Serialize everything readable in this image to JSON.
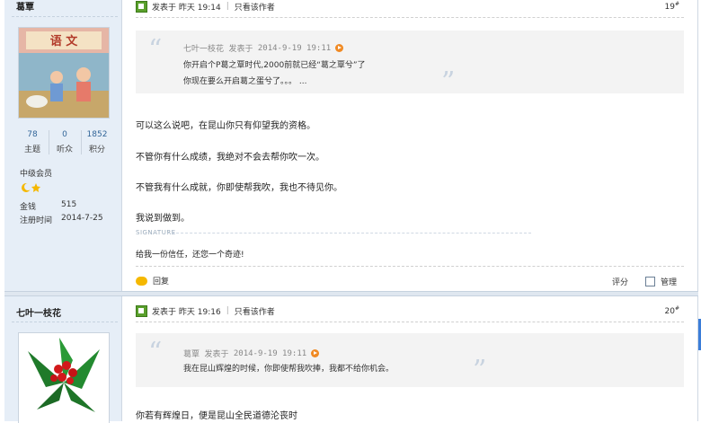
{
  "post1": {
    "username": "葛覃",
    "stats": [
      {
        "num": "78",
        "label": "主题"
      },
      {
        "num": "0",
        "label": "听众"
      },
      {
        "num": "1852",
        "label": "积分"
      }
    ],
    "group": "中级会员",
    "money_label": "金钱",
    "money_value": "515",
    "regtime_label": "注册时间",
    "regtime_value": "2014-7-25",
    "post_meta": "发表于",
    "post_time": "昨天 19:14",
    "only_author": "只看该作者",
    "floor": "19",
    "quote": {
      "author": "七叶一枝花",
      "posted": "发表于",
      "time": "2014-9-19 19:11",
      "lines": [
        "你开启个P葛之覃时代,2000前就已经“葛之覃兮”了",
        "你现在要么开启葛之蛋兮了。。。 ..."
      ]
    },
    "body": [
      "可以这么说吧，在昆山你只有仰望我的资格。",
      "不管你有什么成绩，我绝对不会去帮你吹一次。",
      "不管我有什么成就，你即使帮我吹，我也不待见你。",
      "我说到做到。"
    ],
    "signature_label": "SIGNATURE",
    "signature": "给我一份信任，还您一个奇迹!",
    "reply_label": "回复",
    "rate_label": "评分",
    "manage_label": "管理"
  },
  "post2": {
    "username": "七叶一枝花",
    "post_meta": "发表于",
    "post_time": "昨天 19:16",
    "only_author": "只看该作者",
    "floor": "20",
    "quote": {
      "author": "葛覃",
      "posted": "发表于",
      "time": "2014-9-19 19:11",
      "lines": [
        "我在昆山辉煌的时候，你即使帮我吹捧，我都不给你机会。"
      ]
    },
    "body": [
      "你若有辉煌日，便是昆山全民道德沦丧时"
    ]
  },
  "floor_suffix": "#",
  "colors": {
    "accent_link": "#336699",
    "sidebar_bg": "#e6eef7",
    "quote_bg": "#f3f3f3"
  }
}
